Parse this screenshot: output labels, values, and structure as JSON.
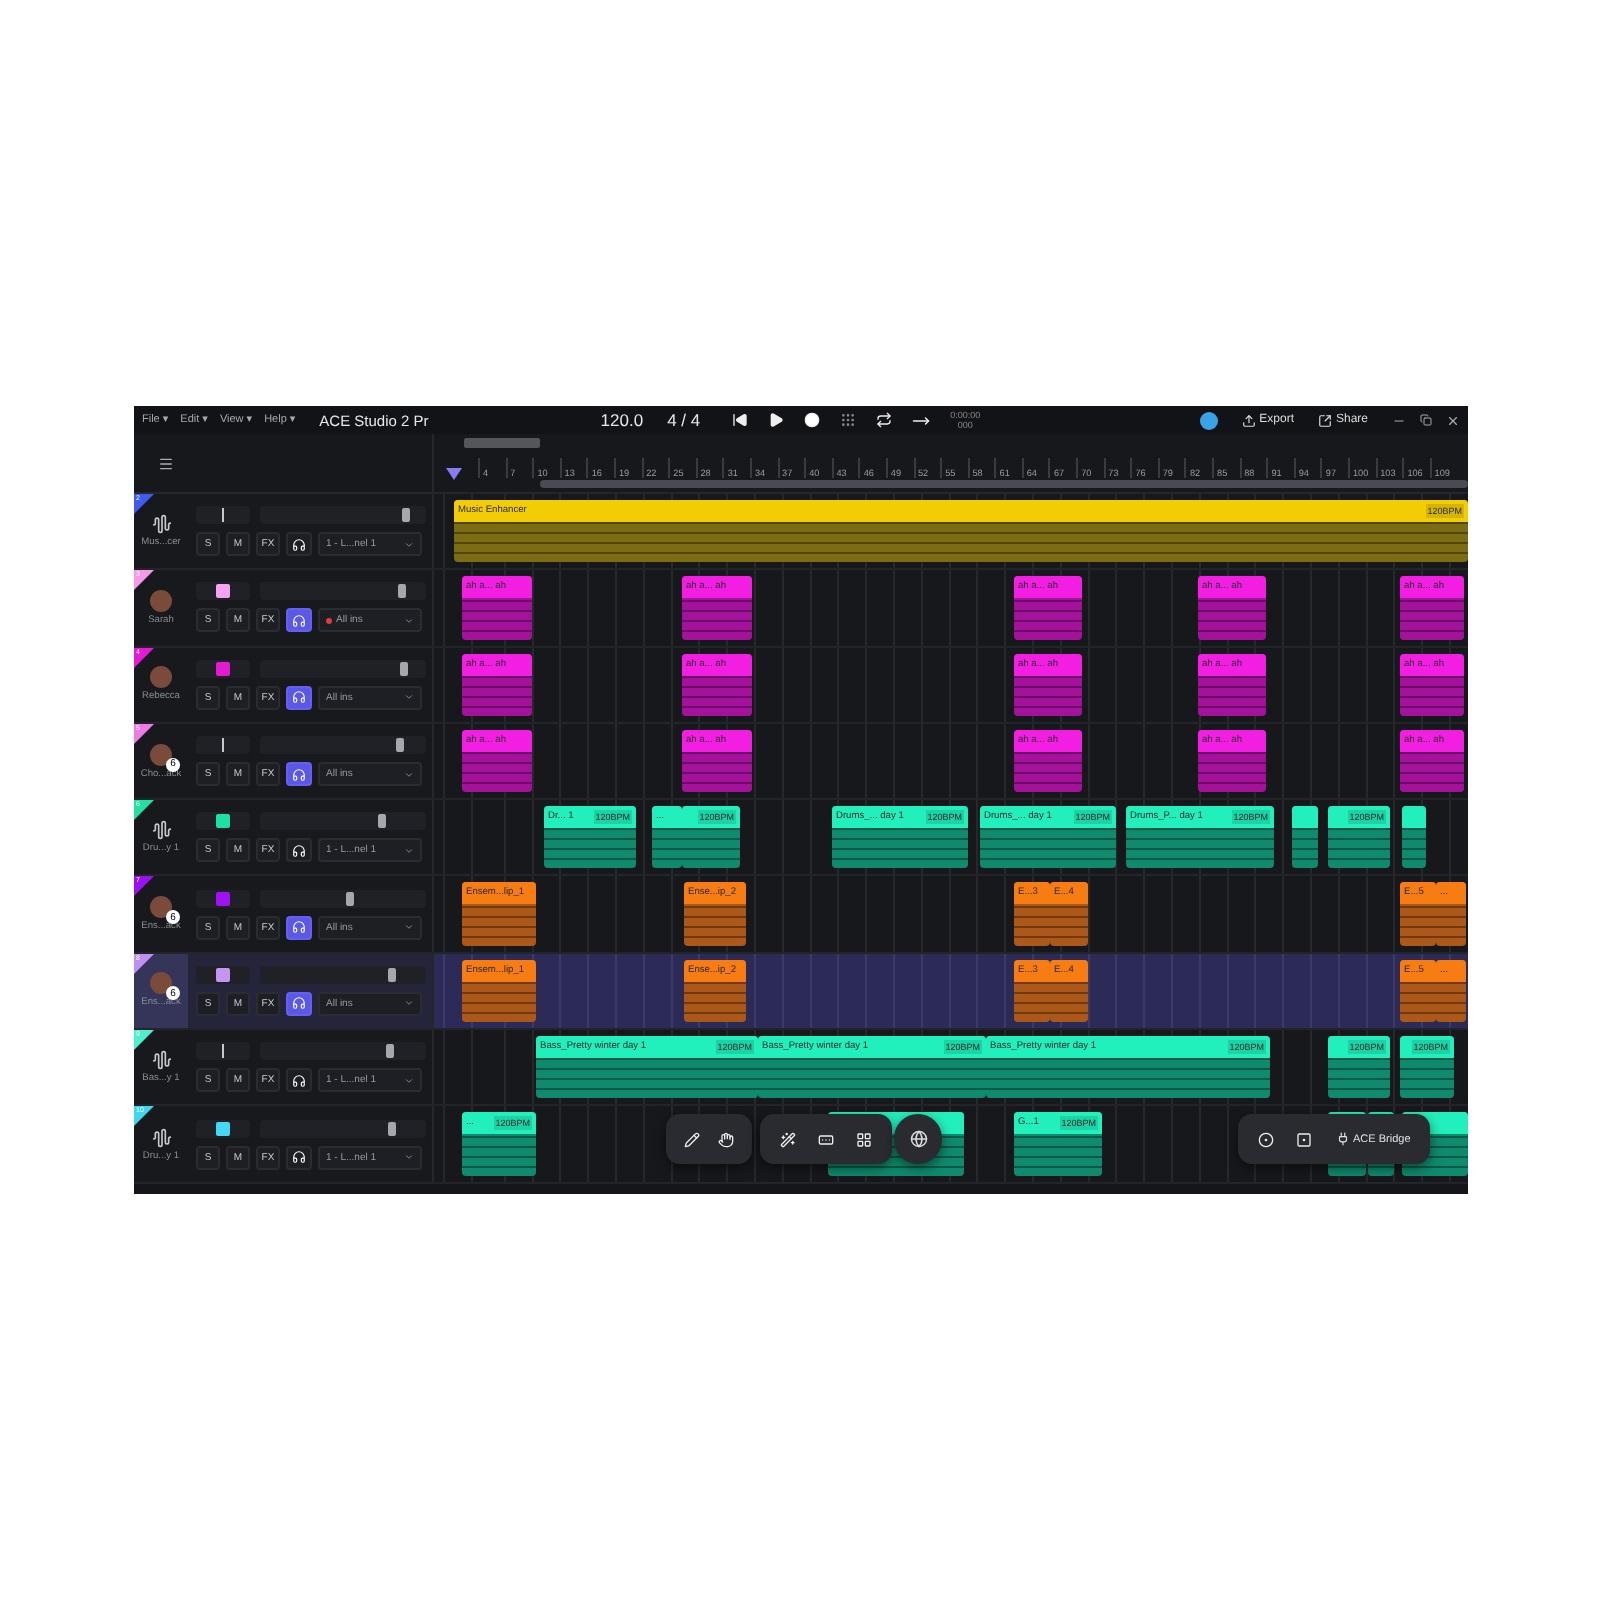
{
  "title_bar": {
    "menus": [
      "File ▾",
      "Edit ▾",
      "View ▾",
      "Help ▾"
    ],
    "app_title": "ACE Studio 2 Pr",
    "tempo": "120.0",
    "time_signature": "4 / 4",
    "time": "0:00:00",
    "frames": "000",
    "export": "Export",
    "share": "Share"
  },
  "ruler": [
    "4",
    "7",
    "10",
    "13",
    "16",
    "19",
    "22",
    "25",
    "28",
    "31",
    "34",
    "37",
    "40",
    "43",
    "46",
    "49",
    "52",
    "55",
    "58",
    "61",
    "64",
    "67",
    "70",
    "73",
    "76",
    "79",
    "82",
    "85",
    "88",
    "91",
    "94",
    "97",
    "100",
    "103",
    "106",
    "109"
  ],
  "tracks": [
    {
      "number": "2",
      "name": "Mus...cer",
      "kind": "enhancer",
      "color": "#3f5cf0",
      "level": 0.88,
      "buttons": [
        "S",
        "M",
        "FX"
      ],
      "monitor": false,
      "input": "1 - L...nel 1",
      "armed": false,
      "selected": false,
      "clips": [
        {
          "kind": "labeled",
          "title": "Music Enhancer",
          "bpm": "120BPM"
        }
      ]
    },
    {
      "number": "3",
      "name": "Sarah",
      "kind": "vocal",
      "color": "#f39ae8",
      "swatch": {
        "color": "#f4a3f2"
      },
      "level": 0.85,
      "buttons": [
        "S",
        "M",
        "FX"
      ],
      "monitor": true,
      "input": "All ins",
      "armed": true,
      "selected": false,
      "clips": [
        {
          "kind": "labeled",
          "title": "ah a... ah"
        },
        {
          "kind": "labeled",
          "title": "ah a... ah"
        },
        {
          "kind": "labeled",
          "title": "ah a... ah"
        },
        {
          "kind": "labeled",
          "title": "ah a... ah"
        },
        {
          "kind": "labeled",
          "title": "ah a... ah"
        }
      ]
    },
    {
      "number": "4",
      "name": "Rebecca",
      "kind": "vocal",
      "color": "#e41ad6",
      "swatch": {
        "color": "#e21ad2"
      },
      "level": 0.87,
      "buttons": [
        "S",
        "M",
        "FX"
      ],
      "monitor": true,
      "input": "All ins",
      "armed": false,
      "selected": false,
      "clips": [
        {
          "kind": "labeled",
          "title": "ah a... ah"
        },
        {
          "kind": "labeled",
          "title": "ah a... ah"
        },
        {
          "kind": "labeled",
          "title": "ah a... ah"
        },
        {
          "kind": "labeled",
          "title": "ah a... ah"
        },
        {
          "kind": "labeled",
          "title": "ah a... ah"
        }
      ]
    },
    {
      "number": "5",
      "name": "Cho...ack",
      "kind": "vocal",
      "color": "#ee7ae6",
      "badge": "6",
      "level": 0.84,
      "buttons": [
        "S",
        "M",
        "FX"
      ],
      "monitor": true,
      "input": "All ins",
      "armed": false,
      "selected": false,
      "clips": [
        {
          "kind": "labeled",
          "title": "ah a... ah"
        },
        {
          "kind": "labeled",
          "title": "ah a... ah"
        },
        {
          "kind": "labeled",
          "title": "ah a... ah"
        },
        {
          "kind": "labeled",
          "title": "ah a... ah"
        },
        {
          "kind": "labeled",
          "title": "ah a... ah"
        }
      ]
    },
    {
      "number": "6",
      "name": "Dru...y 1",
      "kind": "audio",
      "color": "#22e0a0",
      "swatch": {
        "color": "#1fe0a4"
      },
      "level": 0.74,
      "buttons": [
        "S",
        "M",
        "FX"
      ],
      "monitor": false,
      "input": "1 - L...nel 1",
      "armed": false,
      "selected": false,
      "clips": [
        {
          "kind": "labeled",
          "title": "Dr... 1",
          "bpm": "120BPM"
        },
        {
          "kind": "labeled",
          "title": "..."
        },
        {
          "kind": "labeled",
          "bpm": "120BPM"
        },
        {
          "kind": "labeled",
          "title": "Drums_... day 1",
          "bpm": "120BPM"
        },
        {
          "kind": "labeled",
          "title": "Drums_... day 1",
          "bpm": "120BPM"
        },
        {
          "kind": "labeled",
          "title": "Drums_P... day 1",
          "bpm": "120BPM"
        },
        {
          "kind": "blank"
        },
        {
          "kind": "labeled",
          "bpm": "120BPM"
        },
        {
          "kind": "blank"
        }
      ]
    },
    {
      "number": "7",
      "name": "Ens...ack",
      "kind": "ensemble",
      "color": "#9a10ee",
      "swatch": {
        "color": "#a012f2"
      },
      "badge": "6",
      "level": 0.54,
      "buttons": [
        "S",
        "M",
        "FX"
      ],
      "monitor": true,
      "input": "All ins",
      "armed": false,
      "selected": false,
      "clips": [
        {
          "kind": "labeled",
          "title": "Ensem...lip_1"
        },
        {
          "kind": "labeled",
          "title": "Ense...ip_2"
        },
        {
          "kind": "labeled",
          "title": "E...3"
        },
        {
          "kind": "labeled",
          "title": "E...4"
        },
        {
          "kind": "labeled",
          "title": "E...5"
        },
        {
          "kind": "labeled",
          "title": "..."
        }
      ]
    },
    {
      "number": "8",
      "name": "Ens...ack",
      "kind": "ensemble",
      "color": "#c08ff2",
      "swatch": {
        "color": "#c595f4"
      },
      "badge": "6",
      "level": 0.79,
      "buttons": [
        "S",
        "M",
        "FX"
      ],
      "monitor": true,
      "input": "All ins",
      "armed": false,
      "selected": true,
      "clips": [
        {
          "kind": "labeled",
          "title": "Ensem...lip_1"
        },
        {
          "kind": "labeled",
          "title": "Ense...ip_2"
        },
        {
          "kind": "labeled",
          "title": "E...3"
        },
        {
          "kind": "labeled",
          "title": "E...4"
        },
        {
          "kind": "labeled",
          "title": "E...5"
        },
        {
          "kind": "labeled",
          "title": "..."
        }
      ]
    },
    {
      "number": "9",
      "name": "Bas...y 1",
      "kind": "audio",
      "color": "#4ef0cc",
      "level": 0.78,
      "buttons": [
        "S",
        "M",
        "FX"
      ],
      "monitor": false,
      "input": "1 - L...nel 1",
      "armed": false,
      "selected": false,
      "clips": [
        {
          "kind": "labeled",
          "title": "Bass_Pretty winter day 1",
          "bpm": "120BPM"
        },
        {
          "kind": "labeled",
          "title": "Bass_Pretty winter day 1",
          "bpm": "120BPM"
        },
        {
          "kind": "labeled",
          "title": "Bass_Pretty winter day 1",
          "bpm": "120BPM"
        },
        {
          "kind": "labeled",
          "bpm": "120BPM"
        },
        {
          "kind": "labeled",
          "bpm": "120BPM"
        }
      ]
    },
    {
      "number": "10",
      "name": "Dru...y 1",
      "kind": "audio",
      "color": "#3ed6f0",
      "swatch": {
        "color": "#44d8f4"
      },
      "level": 0.79,
      "buttons": [
        "S",
        "M",
        "FX"
      ],
      "monitor": false,
      "input": "1 - L...nel 1",
      "armed": false,
      "selected": false,
      "clips": [
        {
          "kind": "labeled",
          "title": "...",
          "bpm": "120BPM"
        },
        {
          "kind": "blank"
        },
        {
          "kind": "labeled",
          "title": "G...1",
          "bpm": "120BPM"
        },
        {
          "kind": "blank"
        },
        {
          "kind": "blank"
        },
        {
          "kind": "blank"
        }
      ]
    }
  ],
  "bottom_tools": {
    "bridge": "ACE Bridge"
  }
}
